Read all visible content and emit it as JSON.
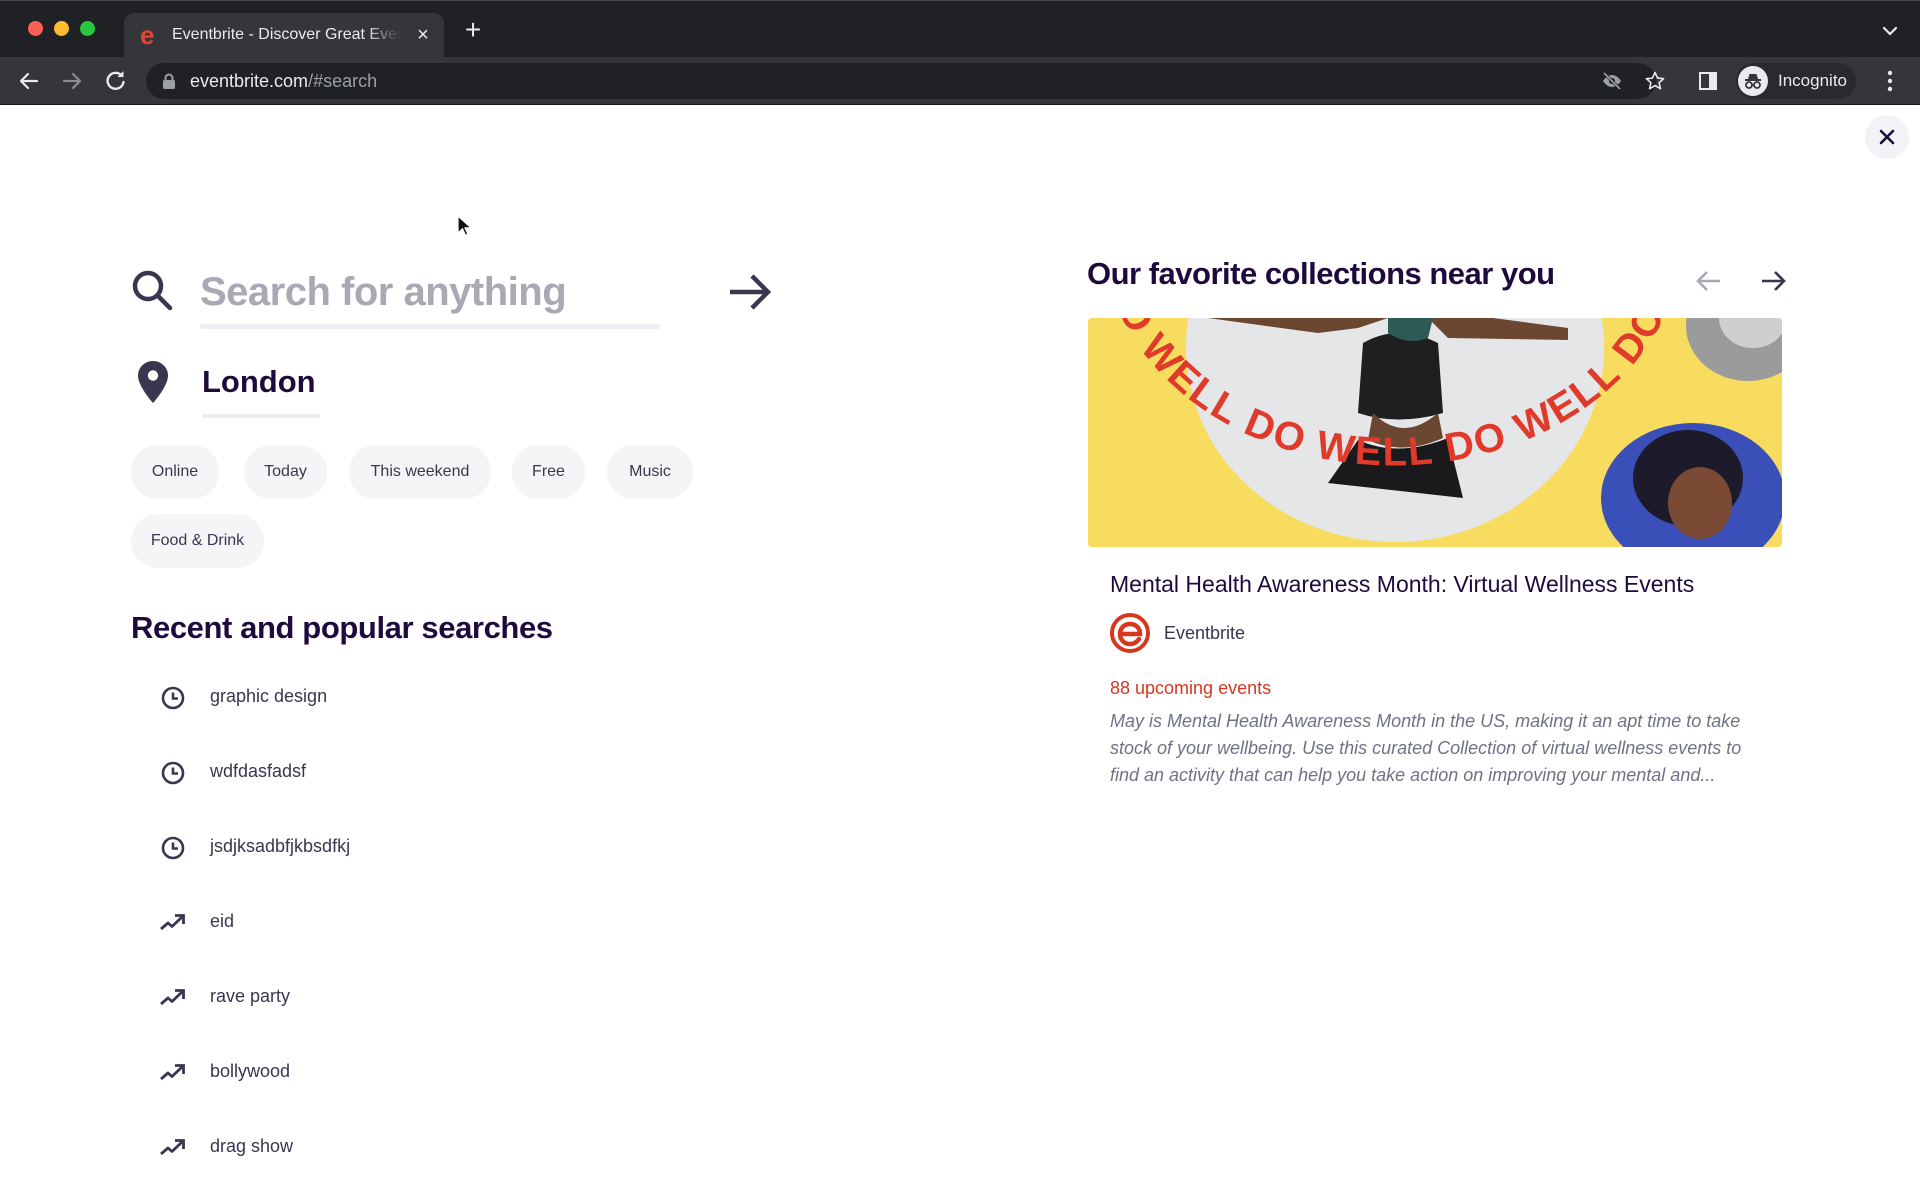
{
  "browser": {
    "tab_title": "Eventbrite - Discover Great Events",
    "tab_favicon": "e",
    "new_tab_label": "+",
    "url_host": "eventbrite.com",
    "url_path": "/#search",
    "profile_label": "Incognito",
    "icons": {
      "back": "arrow-left-icon",
      "forward": "arrow-right-icon",
      "reload": "reload-icon",
      "lock": "lock-icon",
      "tracking": "eye-off-icon",
      "bookmark": "star-icon",
      "side_panel": "side-panel-icon",
      "incognito": "incognito-icon",
      "menu": "kebab-menu-icon",
      "tab_list": "chevron-down-icon"
    }
  },
  "search": {
    "placeholder": "Search for anything",
    "value": "",
    "location_value": "London"
  },
  "chips": [
    {
      "label": "Online"
    },
    {
      "label": "Today"
    },
    {
      "label": "This weekend"
    },
    {
      "label": "Free"
    },
    {
      "label": "Music"
    },
    {
      "label": "Food & Drink"
    }
  ],
  "recent": {
    "heading": "Recent and popular searches",
    "items": [
      {
        "label": "graphic design",
        "icon": "clock-icon",
        "type": "recent"
      },
      {
        "label": "wdfdasfadsf",
        "icon": "clock-icon",
        "type": "recent"
      },
      {
        "label": "jsdjksadbfjkbsdfkj",
        "icon": "clock-icon",
        "type": "recent"
      },
      {
        "label": "eid",
        "icon": "trending-icon",
        "type": "popular"
      },
      {
        "label": "rave party",
        "icon": "trending-icon",
        "type": "popular"
      },
      {
        "label": "bollywood",
        "icon": "trending-icon",
        "type": "popular"
      },
      {
        "label": "drag show",
        "icon": "trending-icon",
        "type": "popular"
      }
    ]
  },
  "collections": {
    "heading": "Our favorite collections near you",
    "card": {
      "title": "Mental Health Awareness Month: Virtual Wellness Events",
      "organizer": "Eventbrite",
      "count_label": "88 upcoming events",
      "description": "May is Mental Health Awareness Month in the US, making it an apt time to take stock of your wellbeing. Use this curated Collection of virtual wellness events to find an activity that can help you take action on improving your mental and...",
      "image_text": "DO WELL DO WELL DO WELL DO WELL"
    }
  },
  "colors": {
    "brand_red": "#d6371f",
    "text_dark": "#1e0a3c",
    "chip_bg": "#f5f5f8",
    "banner_yellow": "#f7dc5f"
  }
}
